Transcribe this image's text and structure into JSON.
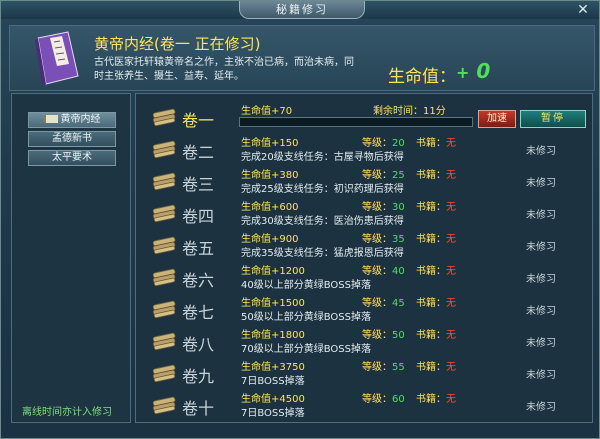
{
  "window": {
    "title": "秘籍修习",
    "close_symbol": "✕"
  },
  "header": {
    "book_title": "黄帝内经(卷一   正在修习)",
    "description": "古代医家托轩辕黄帝名之作，主张不治已病，而治未病，同时主张养生、摄生、益寿、延年。",
    "hp_label": "生命值：",
    "hp_plus": "+",
    "hp_value": "0"
  },
  "left_panel": {
    "books": [
      "黄帝内经",
      "孟德新书",
      "太平要术"
    ],
    "offline_note": "离线时间亦计入修习"
  },
  "active_volume": {
    "remain_label": "剩余时间：11分",
    "progress": 0.0,
    "speed_label": "加速",
    "pause_label": "暂停"
  },
  "volumes": [
    {
      "name": "卷一",
      "bonus": "生命值+70",
      "level_label": "",
      "level": "",
      "book_label": "",
      "book": "",
      "condition": "",
      "status": ""
    },
    {
      "name": "卷二",
      "bonus": "生命值+150",
      "level_label": "等级：",
      "level": "20",
      "book_label": "书籍：",
      "book": "无",
      "condition": "完成20级支线任务：古屋寻物后获得",
      "status": "未修习"
    },
    {
      "name": "卷三",
      "bonus": "生命值+380",
      "level_label": "等级：",
      "level": "25",
      "book_label": "书籍：",
      "book": "无",
      "condition": "完成25级支线任务：初识药理后获得",
      "status": "未修习"
    },
    {
      "name": "卷四",
      "bonus": "生命值+600",
      "level_label": "等级：",
      "level": "30",
      "book_label": "书籍：",
      "book": "无",
      "condition": "完成30级支线任务：医治伤患后获得",
      "status": "未修习"
    },
    {
      "name": "卷五",
      "bonus": "生命值+900",
      "level_label": "等级：",
      "level": "35",
      "book_label": "书籍：",
      "book": "无",
      "condition": "完成35级支线任务：猛虎报恩后获得",
      "status": "未修习"
    },
    {
      "name": "卷六",
      "bonus": "生命值+1200",
      "level_label": "等级：",
      "level": "40",
      "book_label": "书籍：",
      "book": "无",
      "condition": "40级以上部分黄绿BOSS掉落",
      "status": "未修习"
    },
    {
      "name": "卷七",
      "bonus": "生命值+1500",
      "level_label": "等级：",
      "level": "45",
      "book_label": "书籍：",
      "book": "无",
      "condition": "50级以上部分黄绿BOSS掉落",
      "status": "未修习"
    },
    {
      "name": "卷八",
      "bonus": "生命值+1800",
      "level_label": "等级：",
      "level": "50",
      "book_label": "书籍：",
      "book": "无",
      "condition": "70级以上部分黄绿BOSS掉落",
      "status": "未修习"
    },
    {
      "name": "卷九",
      "bonus": "生命值+3750",
      "level_label": "等级：",
      "level": "55",
      "book_label": "书籍：",
      "book": "无",
      "condition": "7日BOSS掉落",
      "status": "未修习"
    },
    {
      "name": "卷十",
      "bonus": "生命值+4500",
      "level_label": "等级：",
      "level": "60",
      "book_label": "书籍：",
      "book": "无",
      "condition": "7日BOSS掉落",
      "status": "未修习"
    }
  ],
  "colors": {
    "accent_yellow": "#ffe35a",
    "value_green": "#4fe05b",
    "missing_red": "#ff4a3a",
    "offline_green": "#7fe07a"
  }
}
